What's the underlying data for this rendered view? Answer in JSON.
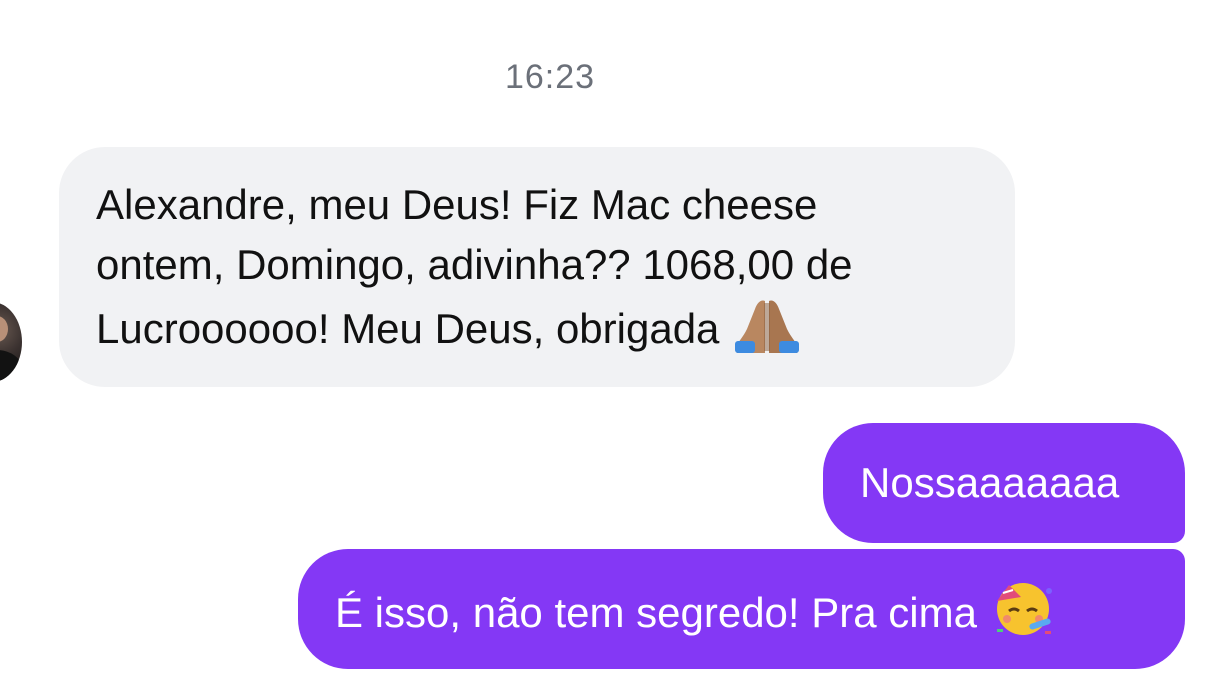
{
  "conversation": {
    "timestamp": "16:23",
    "incoming": {
      "lines": [
        "Alexandre, meu Deus! Fiz Mac cheese",
        "ontem, Domingo, adivinha?? 1068,00 de",
        "Lucroooooo! Meu Deus, obrigada"
      ],
      "emoji": "praying-hands-emoji"
    },
    "outgoing": [
      {
        "text": "Nossaaaaaaa"
      },
      {
        "text": "É isso, não tem segredo! Pra cima",
        "emoji": "partying-face-emoji"
      }
    ]
  },
  "colors": {
    "incoming_bubble": "#f1f2f4",
    "outgoing_bubble": "#8438f5",
    "timestamp_text": "#6b7079"
  }
}
